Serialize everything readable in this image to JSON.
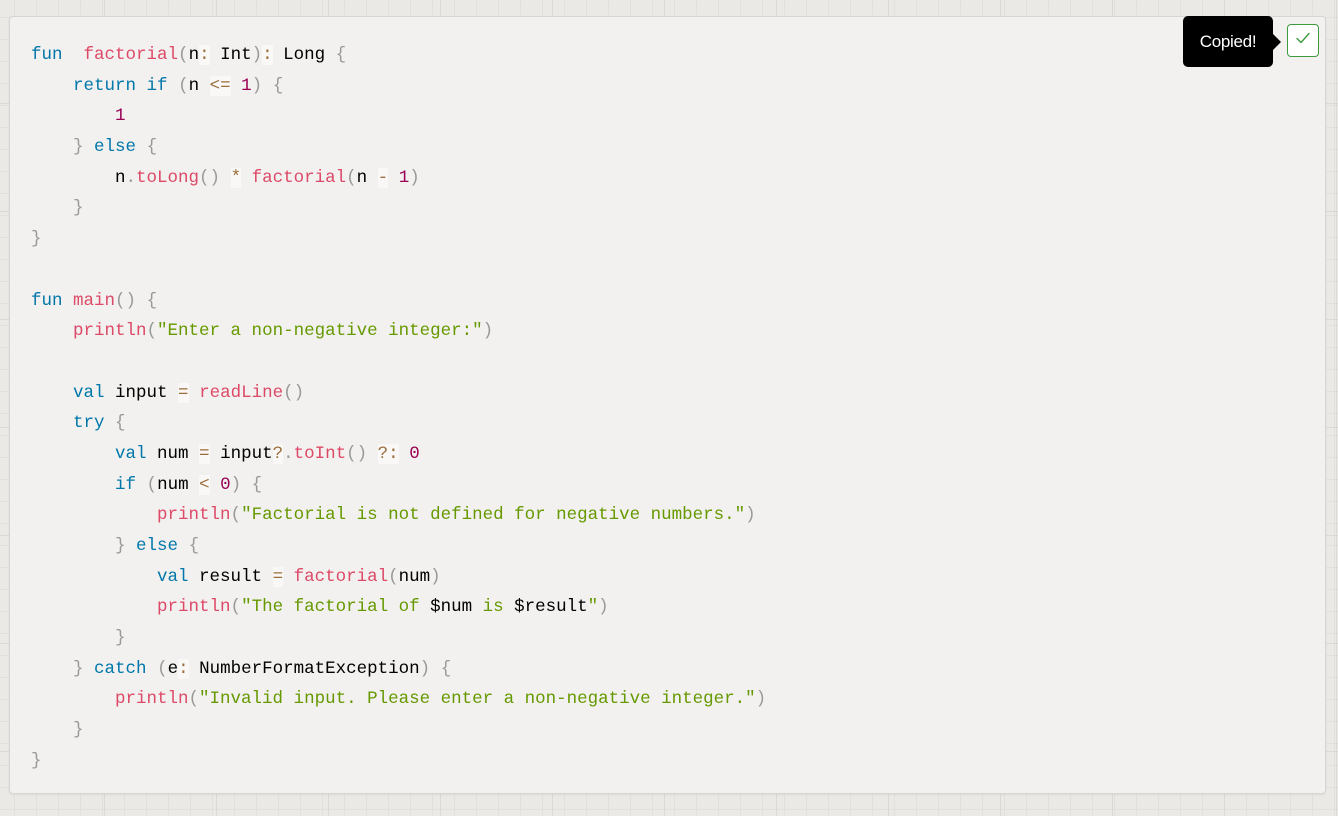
{
  "code_block": {
    "language": "kotlin",
    "lines": [
      [
        [
          "kw",
          "fun"
        ],
        [
          "",
          "  "
        ],
        [
          "fn",
          "factorial"
        ],
        [
          "pun",
          "("
        ],
        [
          "",
          "n"
        ],
        [
          "op",
          ":"
        ],
        [
          "",
          " Int"
        ],
        [
          "pun",
          ")"
        ],
        [
          "op",
          ":"
        ],
        [
          "",
          " Long "
        ],
        [
          "pun",
          "{"
        ]
      ],
      [
        [
          "",
          "    "
        ],
        [
          "kw",
          "return"
        ],
        [
          "",
          " "
        ],
        [
          "kw",
          "if"
        ],
        [
          "",
          " "
        ],
        [
          "pun",
          "("
        ],
        [
          "",
          "n "
        ],
        [
          "op",
          "<="
        ],
        [
          "",
          " "
        ],
        [
          "num",
          "1"
        ],
        [
          "pun",
          ")"
        ],
        [
          "",
          " "
        ],
        [
          "pun",
          "{"
        ]
      ],
      [
        [
          "",
          "        "
        ],
        [
          "num",
          "1"
        ]
      ],
      [
        [
          "",
          "    "
        ],
        [
          "pun",
          "}"
        ],
        [
          "",
          " "
        ],
        [
          "kw",
          "else"
        ],
        [
          "",
          " "
        ],
        [
          "pun",
          "{"
        ]
      ],
      [
        [
          "",
          "        n"
        ],
        [
          "pun",
          "."
        ],
        [
          "fn",
          "toLong"
        ],
        [
          "pun",
          "()"
        ],
        [
          "",
          " "
        ],
        [
          "op",
          "*"
        ],
        [
          "",
          " "
        ],
        [
          "fn",
          "factorial"
        ],
        [
          "pun",
          "("
        ],
        [
          "",
          "n "
        ],
        [
          "op",
          "-"
        ],
        [
          "",
          " "
        ],
        [
          "num",
          "1"
        ],
        [
          "pun",
          ")"
        ]
      ],
      [
        [
          "",
          "    "
        ],
        [
          "pun",
          "}"
        ]
      ],
      [
        [
          "pun",
          "}"
        ]
      ],
      [],
      [
        [
          "kw",
          "fun"
        ],
        [
          "",
          " "
        ],
        [
          "fn",
          "main"
        ],
        [
          "pun",
          "()"
        ],
        [
          "",
          " "
        ],
        [
          "pun",
          "{"
        ]
      ],
      [
        [
          "",
          "    "
        ],
        [
          "fn",
          "println"
        ],
        [
          "pun",
          "("
        ],
        [
          "str",
          "\"Enter a non-negative integer:\""
        ],
        [
          "pun",
          ")"
        ]
      ],
      [],
      [
        [
          "",
          "    "
        ],
        [
          "kw",
          "val"
        ],
        [
          "",
          " input "
        ],
        [
          "op",
          "="
        ],
        [
          "",
          " "
        ],
        [
          "fn",
          "readLine"
        ],
        [
          "pun",
          "()"
        ]
      ],
      [
        [
          "",
          "    "
        ],
        [
          "kw",
          "try"
        ],
        [
          "",
          " "
        ],
        [
          "pun",
          "{"
        ]
      ],
      [
        [
          "",
          "        "
        ],
        [
          "kw",
          "val"
        ],
        [
          "",
          " num "
        ],
        [
          "op",
          "="
        ],
        [
          "",
          " input"
        ],
        [
          "op",
          "?"
        ],
        [
          "pun",
          "."
        ],
        [
          "fn",
          "toInt"
        ],
        [
          "pun",
          "()"
        ],
        [
          "",
          " "
        ],
        [
          "op",
          "?:"
        ],
        [
          "",
          " "
        ],
        [
          "num",
          "0"
        ]
      ],
      [
        [
          "",
          "        "
        ],
        [
          "kw",
          "if"
        ],
        [
          "",
          " "
        ],
        [
          "pun",
          "("
        ],
        [
          "",
          "num "
        ],
        [
          "op",
          "<"
        ],
        [
          "",
          " "
        ],
        [
          "num",
          "0"
        ],
        [
          "pun",
          ")"
        ],
        [
          "",
          " "
        ],
        [
          "pun",
          "{"
        ]
      ],
      [
        [
          "",
          "            "
        ],
        [
          "fn",
          "println"
        ],
        [
          "pun",
          "("
        ],
        [
          "str",
          "\"Factorial is not defined for negative numbers.\""
        ],
        [
          "pun",
          ")"
        ]
      ],
      [
        [
          "",
          "        "
        ],
        [
          "pun",
          "}"
        ],
        [
          "",
          " "
        ],
        [
          "kw",
          "else"
        ],
        [
          "",
          " "
        ],
        [
          "pun",
          "{"
        ]
      ],
      [
        [
          "",
          "            "
        ],
        [
          "kw",
          "val"
        ],
        [
          "",
          " result "
        ],
        [
          "op",
          "="
        ],
        [
          "",
          " "
        ],
        [
          "fn",
          "factorial"
        ],
        [
          "pun",
          "("
        ],
        [
          "",
          "num"
        ],
        [
          "pun",
          ")"
        ]
      ],
      [
        [
          "",
          "            "
        ],
        [
          "fn",
          "println"
        ],
        [
          "pun",
          "("
        ],
        [
          "str",
          "\"The factorial of "
        ],
        [
          "",
          "$num"
        ],
        [
          "str",
          " is "
        ],
        [
          "",
          "$result"
        ],
        [
          "str",
          "\""
        ],
        [
          "pun",
          ")"
        ]
      ],
      [
        [
          "",
          "        "
        ],
        [
          "pun",
          "}"
        ]
      ],
      [
        [
          "",
          "    "
        ],
        [
          "pun",
          "}"
        ],
        [
          "",
          " "
        ],
        [
          "kw",
          "catch"
        ],
        [
          "",
          " "
        ],
        [
          "pun",
          "("
        ],
        [
          "",
          "e"
        ],
        [
          "op",
          ":"
        ],
        [
          "",
          " NumberFormatException"
        ],
        [
          "pun",
          ")"
        ],
        [
          "",
          " "
        ],
        [
          "pun",
          "{"
        ]
      ],
      [
        [
          "",
          "        "
        ],
        [
          "fn",
          "println"
        ],
        [
          "pun",
          "("
        ],
        [
          "str",
          "\"Invalid input. Please enter a non-negative integer.\""
        ],
        [
          "pun",
          ")"
        ]
      ],
      [
        [
          "",
          "    "
        ],
        [
          "pun",
          "}"
        ]
      ],
      [
        [
          "pun",
          "}"
        ]
      ]
    ]
  },
  "tooltip": {
    "text": "Copied!"
  },
  "copy_button": {
    "icon": "check-icon",
    "state": "copied",
    "accent_color": "#3f9a3f"
  },
  "theme": {
    "keyword": "#0077aa",
    "function": "#dd4a68",
    "string": "#669900",
    "number": "#990055",
    "punctuation": "#999999",
    "operator": "#9a6e3a"
  }
}
